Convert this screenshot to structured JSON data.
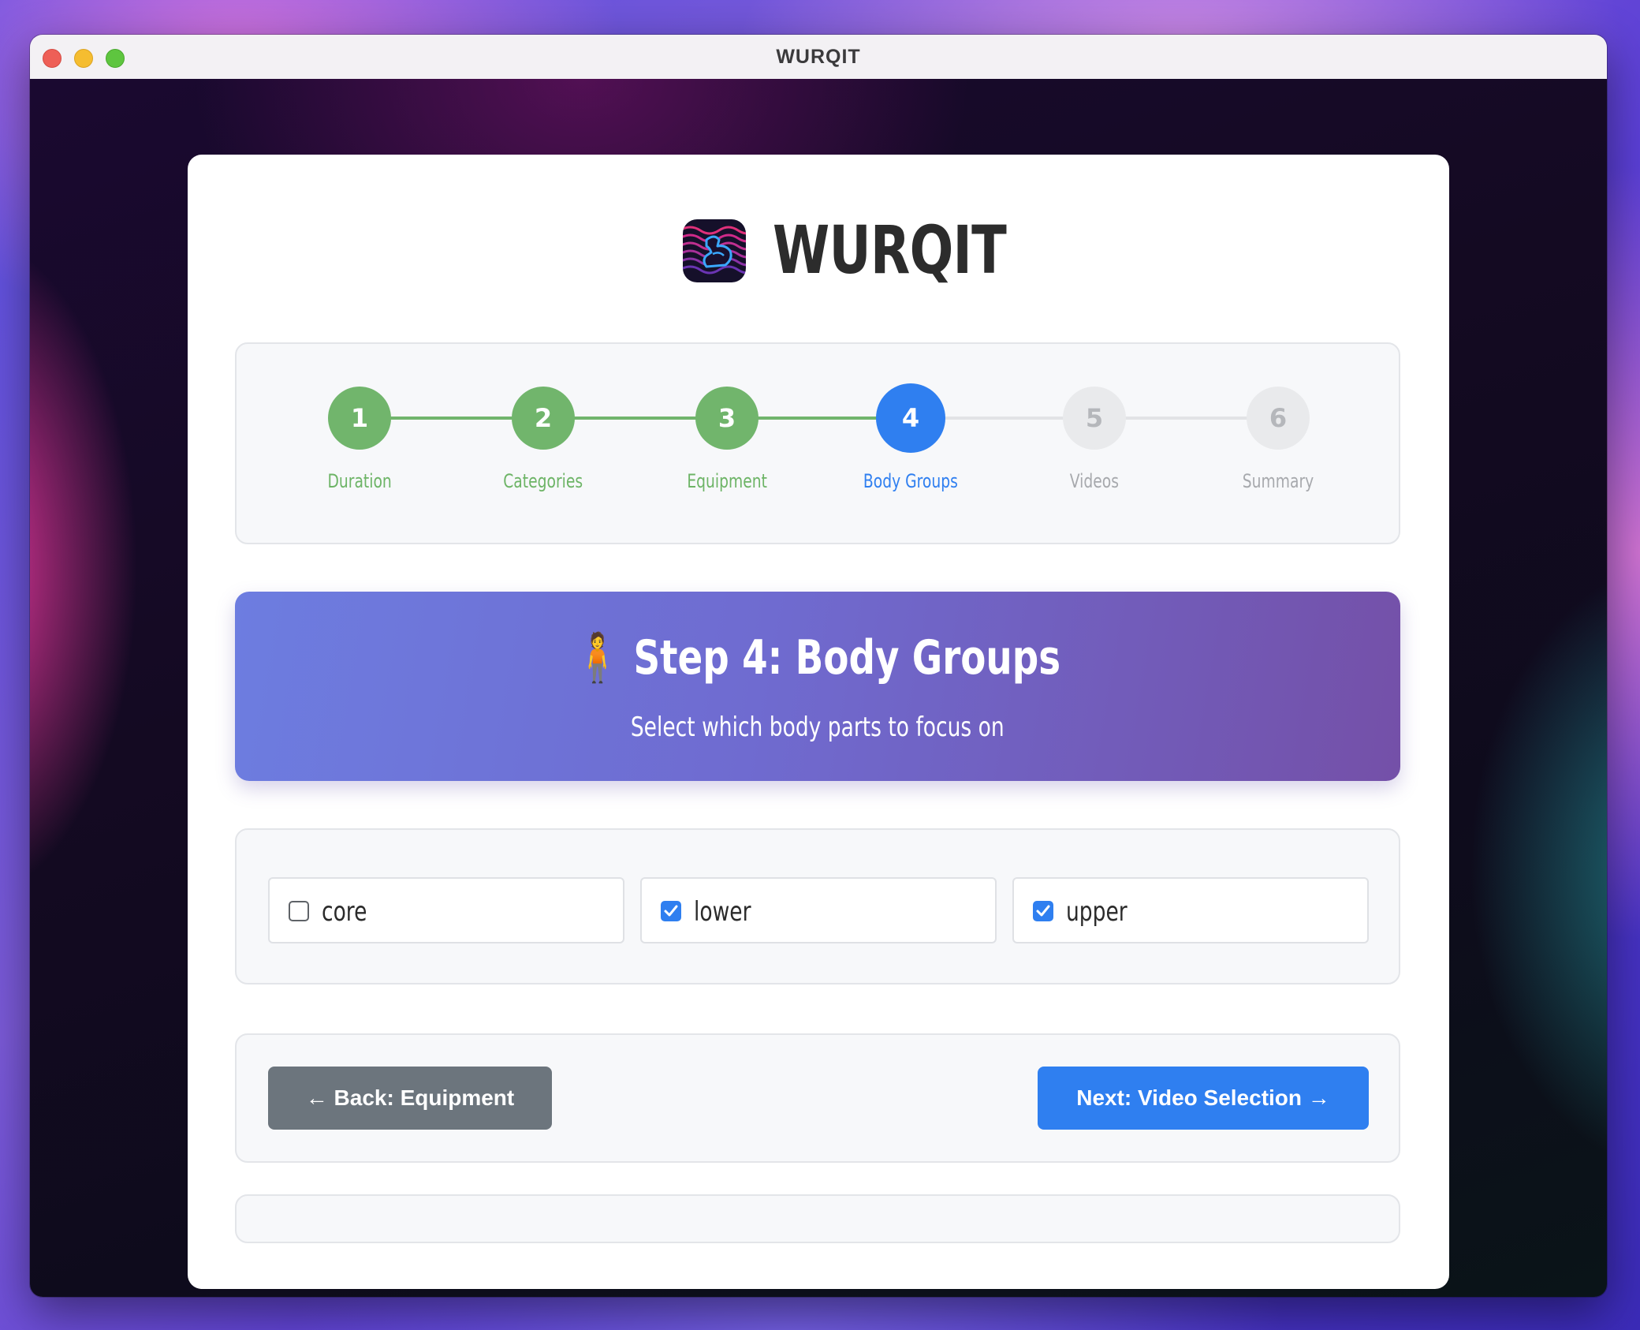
{
  "window": {
    "title": "WURQIT"
  },
  "brand": {
    "name": "WURQIT",
    "icon": "flexed-bicep-icon"
  },
  "progress": {
    "steps": [
      {
        "number": "1",
        "label": "Duration",
        "state": "completed"
      },
      {
        "number": "2",
        "label": "Categories",
        "state": "completed"
      },
      {
        "number": "3",
        "label": "Equipment",
        "state": "completed"
      },
      {
        "number": "4",
        "label": "Body Groups",
        "state": "active"
      },
      {
        "number": "5",
        "label": "Videos",
        "state": "upcoming"
      },
      {
        "number": "6",
        "label": "Summary",
        "state": "upcoming"
      }
    ]
  },
  "hero": {
    "emoji": "🧍",
    "title": "Step 4: Body Groups",
    "subtitle": "Select which body parts to focus on"
  },
  "options": [
    {
      "label": "core",
      "checked": false
    },
    {
      "label": "lower",
      "checked": true
    },
    {
      "label": "upper",
      "checked": true
    }
  ],
  "nav": {
    "back_label": "← Back: Equipment",
    "next_label": "Next: Video Selection →"
  },
  "colors": {
    "completed": "#71b56c",
    "active": "#2f7ff0",
    "upcoming": "#e9eaec",
    "back_button": "#6c757d",
    "next_button": "#2f7ff0",
    "hero_gradient_start": "#6d7de0",
    "hero_gradient_end": "#7450a8"
  }
}
